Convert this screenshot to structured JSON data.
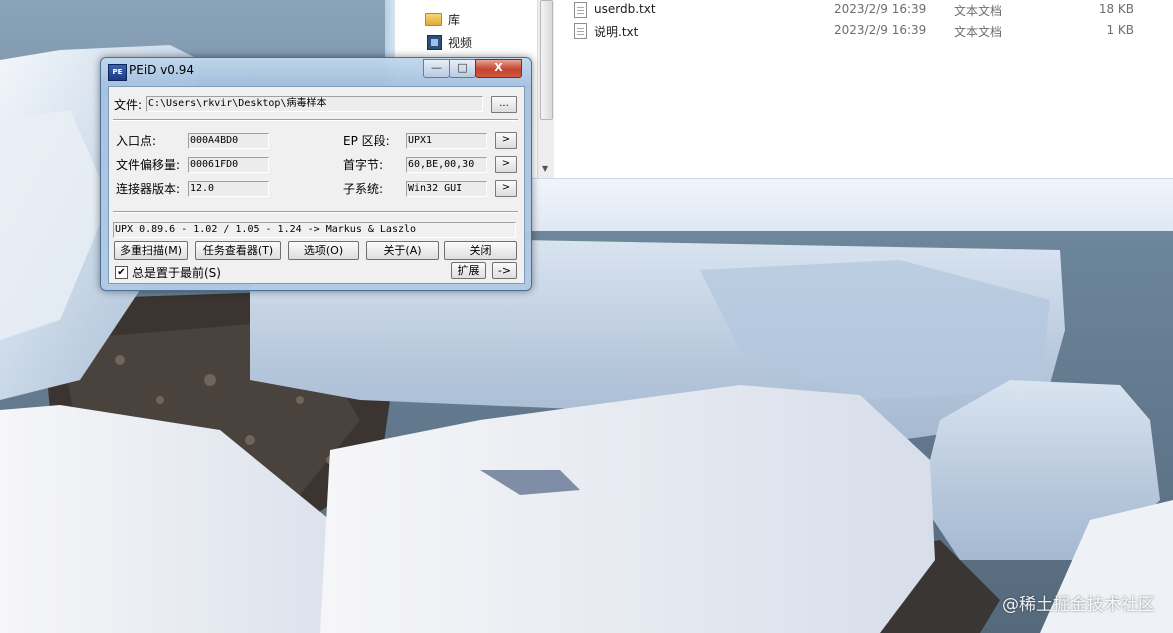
{
  "desktop": {
    "watermark": "@稀土掘金技术社区"
  },
  "explorer": {
    "nav_items": [
      {
        "label": "库",
        "icon": "library-folder-icon"
      },
      {
        "label": "视频",
        "icon": "video-library-icon"
      }
    ],
    "files": [
      {
        "name": "userdb.txt",
        "date": "2023/2/9 16:39",
        "type": "文本文档",
        "size": "18 KB"
      },
      {
        "name": "说明.txt",
        "date": "2023/2/9 16:39",
        "type": "文本文档",
        "size": "1 KB"
      }
    ]
  },
  "peid": {
    "title": "PEiD v0.94",
    "icon_text": "PE",
    "caption": {
      "minimize": "—",
      "maximize": "□",
      "close": "X"
    },
    "file_label": "文件:",
    "file_path": "C:\\Users\\rkvir\\Desktop\\病毒样本",
    "browse_label": "...",
    "entry_point_label": "入口点:",
    "entry_point": "000A4BD0",
    "file_offset_label": "文件偏移量:",
    "file_offset": "00061FD0",
    "linker_label": "连接器版本:",
    "linker_version": "12.0",
    "ep_section_label": "EP 区段:",
    "ep_section": "UPX1",
    "first_bytes_label": "首字节:",
    "first_bytes": "60,BE,00,30",
    "subsystem_label": "子系统:",
    "subsystem": "Win32 GUI",
    "arrow": ">",
    "detection": "UPX 0.89.6 - 1.02 / 1.05 - 1.24 -> Markus & Laszlo",
    "buttons": {
      "multi_scan": "多重扫描(M)",
      "task_viewer": "任务查看器(T)",
      "options": "选项(O)",
      "about": "关于(A)",
      "exit": "关闭",
      "extend": "扩展",
      "more": "->"
    },
    "stay_on_top_label": "总是置于最前(S)",
    "stay_on_top_check": "✔"
  }
}
